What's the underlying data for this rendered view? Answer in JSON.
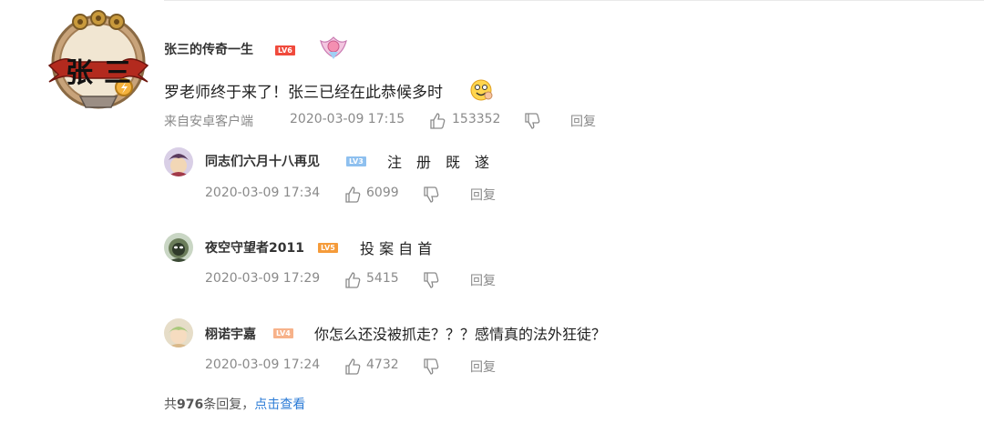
{
  "main_comment": {
    "avatar_text": [
      "张",
      "三"
    ],
    "username": "张三的传奇一生",
    "level": "LV6",
    "text": "罗老师终于来了！张三已经在此恭候多时",
    "source": "来自安卓客户端",
    "time": "2020-03-09 17:15",
    "likes": "153352",
    "reply_label": "回复"
  },
  "replies": [
    {
      "username": "同志们六月十八再见",
      "level": "LV3",
      "text": "注　册　既　遂",
      "time": "2020-03-09 17:34",
      "likes": "6099",
      "reply_label": "回复"
    },
    {
      "username": "夜空守望者2011",
      "level": "LV5",
      "text": "投 案 自 首",
      "time": "2020-03-09 17:29",
      "likes": "5415",
      "reply_label": "回复"
    },
    {
      "username": "栩诺宇嘉",
      "level": "LV4",
      "text": "你怎么还没被抓走？？？感情真的法外狂徒？",
      "time": "2020-03-09 17:24",
      "likes": "4732",
      "reply_label": "回复"
    }
  ],
  "footer": {
    "total_prefix": "共",
    "total_count": "976",
    "total_suffix": "条回复，",
    "view_link": "点击查看"
  },
  "colors": {
    "link": "#2b7bd6",
    "lv6": "#f04a3c",
    "lv3": "#8ec0ef",
    "lv5": "#f59b3a",
    "lv4": "#f7b28a",
    "meta": "#8a8a8a"
  },
  "icons": [
    "thumbs-up-icon",
    "thumbs-down-icon",
    "laughing-emoji-icon",
    "medal-badge-icon"
  ]
}
